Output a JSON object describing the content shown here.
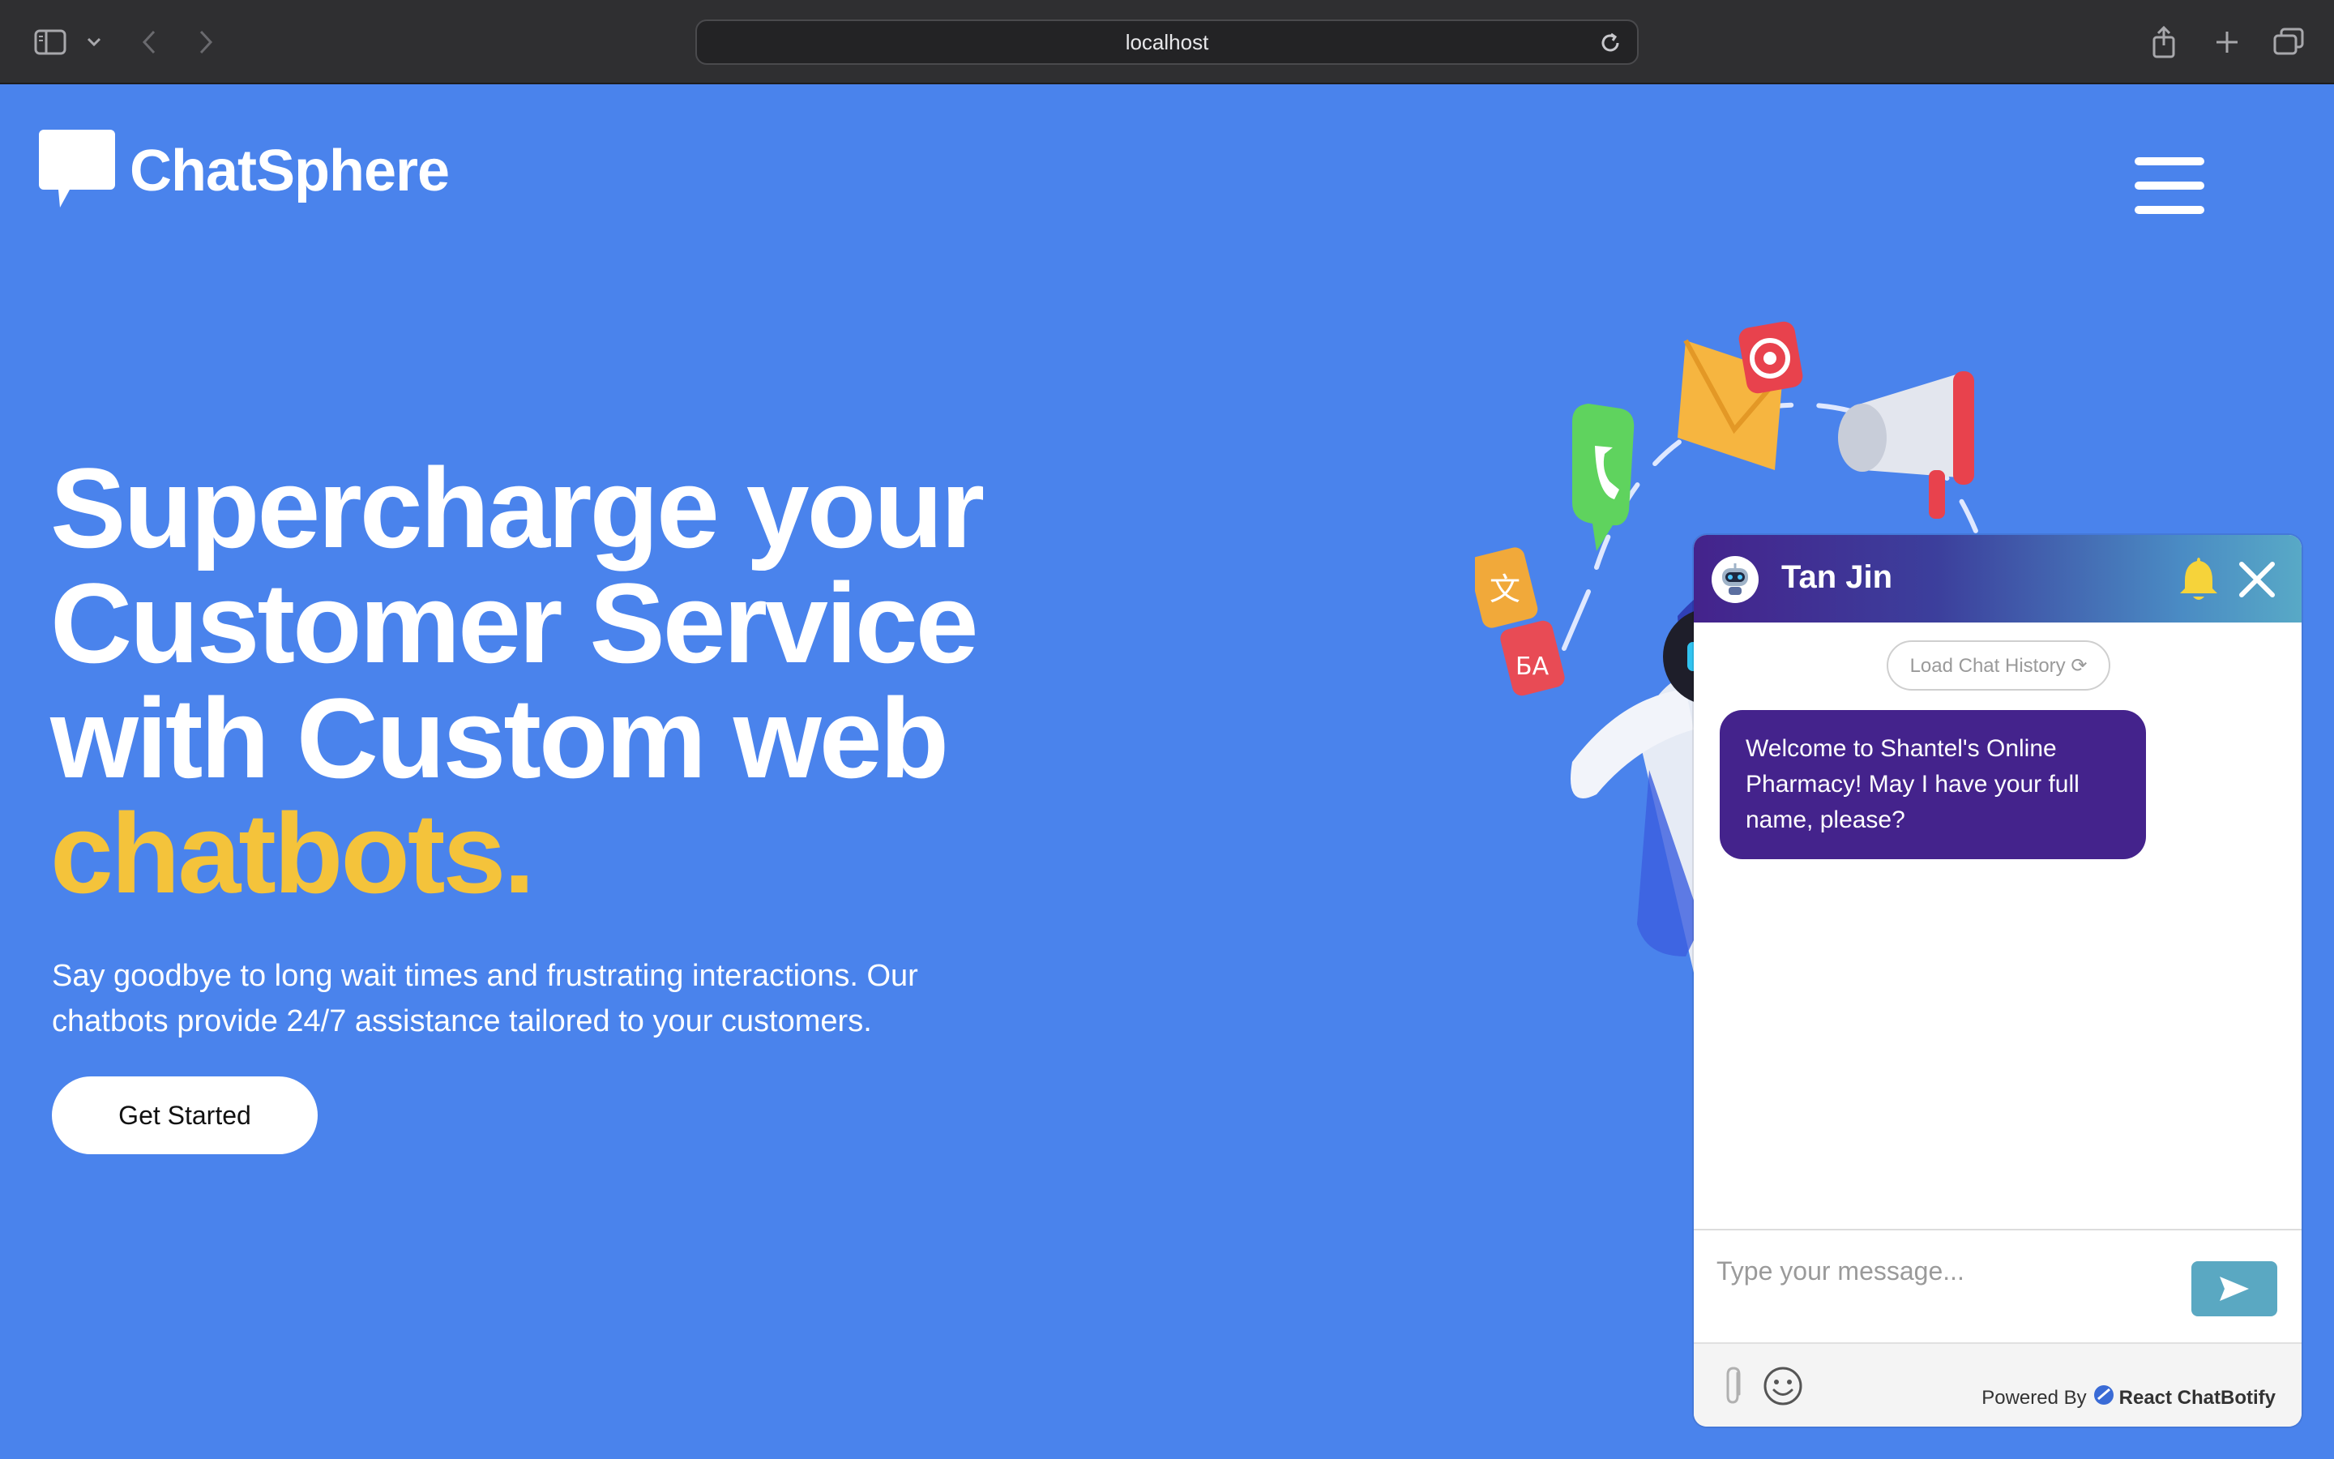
{
  "browser": {
    "url": "localhost",
    "icons": [
      "sidebar-icon",
      "chevron-down-icon",
      "back-icon",
      "forward-icon",
      "reload-icon",
      "share-icon",
      "new-tab-icon",
      "tab-overview-icon"
    ]
  },
  "site": {
    "brand": "ChatSphere",
    "menu_icon": "hamburger-icon"
  },
  "hero": {
    "title_line1": "Supercharge your",
    "title_line2": "Customer Service",
    "title_line3": "with Custom web",
    "title_accent": "chatbots.",
    "subtitle": "Say goodbye to long wait times and frustrating interactions. Our chatbots provide 24/7 assistance tailored to your customers.",
    "cta": "Get Started"
  },
  "chat": {
    "name": "Tan Jin",
    "load_history": "Load Chat History ⟳",
    "messages": [
      {
        "from": "bot",
        "text": "Welcome to Shantel's Online Pharmacy! May I have your full name, please?"
      }
    ],
    "input_placeholder": "Type your message...",
    "powered_by": "Powered By",
    "powered_brand": "React ChatBotify"
  },
  "colors": {
    "page_bg": "#4a83ec",
    "accent": "#f4c33b",
    "chat_primary": "#44238c",
    "chat_secondary": "#5aa8c2"
  }
}
